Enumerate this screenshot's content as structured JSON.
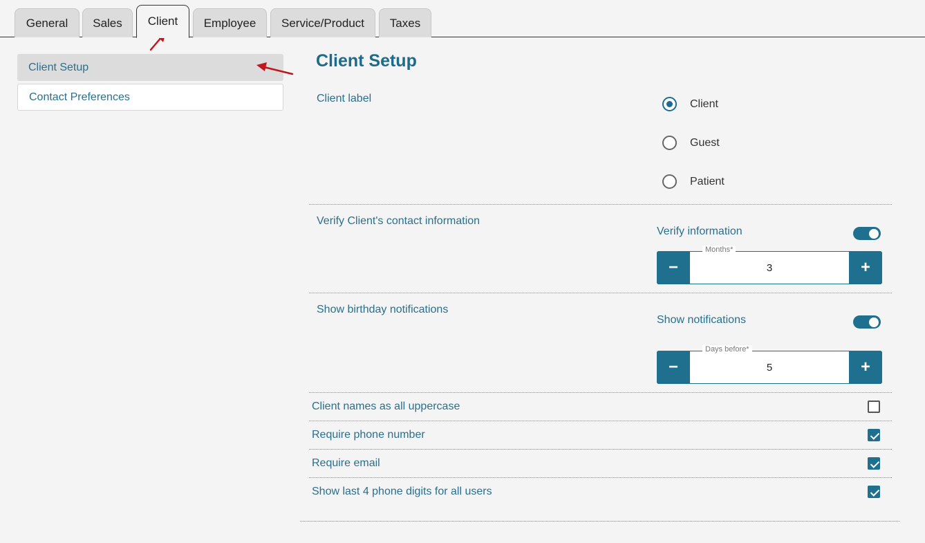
{
  "tabs": [
    {
      "label": "General"
    },
    {
      "label": "Sales"
    },
    {
      "label": "Client",
      "active": true
    },
    {
      "label": "Employee"
    },
    {
      "label": "Service/Product"
    },
    {
      "label": "Taxes"
    }
  ],
  "sidebar": {
    "items": [
      {
        "label": "Client Setup",
        "active": true
      },
      {
        "label": "Contact Preferences"
      }
    ]
  },
  "main": {
    "title": "Client Setup",
    "client_label": {
      "label": "Client label",
      "options": [
        "Client",
        "Guest",
        "Patient"
      ],
      "selected": "Client"
    },
    "verify": {
      "label": "Verify Client's contact information",
      "toggle_label": "Verify information",
      "toggle_on": true,
      "field_legend": "Months*",
      "value": "3",
      "minus": "−",
      "plus": "+"
    },
    "birthday": {
      "label": "Show birthday notifications",
      "toggle_label": "Show notifications",
      "toggle_on": true,
      "field_legend": "Days before*",
      "value": "5",
      "minus": "−",
      "plus": "+"
    },
    "checks": [
      {
        "label": "Client names as all uppercase",
        "checked": false
      },
      {
        "label": "Require phone number",
        "checked": true
      },
      {
        "label": "Require email",
        "checked": true
      },
      {
        "label": "Show last 4 phone digits for all users",
        "checked": true
      }
    ]
  },
  "colors": {
    "accent": "#1f6f8f",
    "text": "#2a6f8d",
    "annotation_arrow": "#c0171c"
  }
}
